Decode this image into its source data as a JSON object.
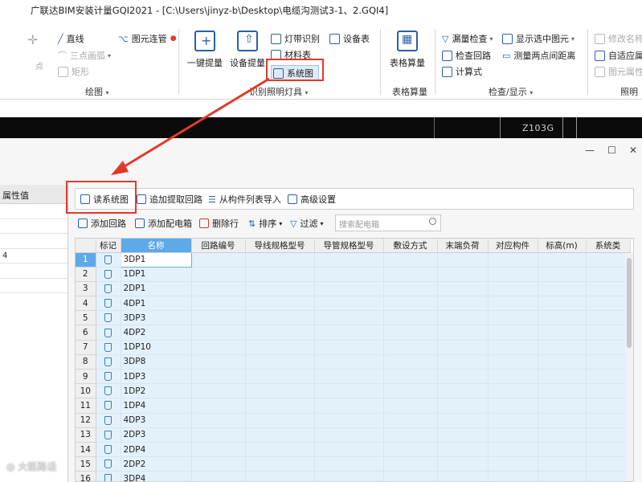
{
  "window": {
    "title": "广联达BIM安装计量GQI2021 - [C:\\Users\\jinyz-b\\Desktop\\电缆沟测试3-1、2.GQI4]"
  },
  "ribbon": {
    "draw_group": {
      "label": "绘图",
      "point": "点",
      "line": "直线",
      "three_point_arc": "三点画弧",
      "rect": "矩形",
      "connect_pipe": "图元连管"
    },
    "lighting_group": {
      "label": "识别照明灯具",
      "one_click": "一键提量",
      "device_extract": "设备提量",
      "light_strip": "灯带识别",
      "device_table": "设备表",
      "material_table": "材料表",
      "system_diagram": "系统图"
    },
    "table_group": {
      "label": "表格算量",
      "table_calc": "表格算量"
    },
    "check_group": {
      "label": "检查/显示",
      "missing_check": "漏量检查",
      "show_selected": "显示选中图元",
      "check_loop": "检查回路",
      "measure_distance": "测量两点间距离",
      "formula": "计算式"
    },
    "right_group": {
      "label": "照明",
      "modify_name": "修改名称",
      "auto_adapt": "自适应属性",
      "component_attr": "图元属性"
    }
  },
  "drawing": {
    "label": "Z103G"
  },
  "dialog": {
    "window_controls": [
      "—",
      "☐",
      "✕"
    ],
    "left_panel": {
      "header": "属性值",
      "rows": [
        "",
        "",
        "",
        "4",
        "",
        ""
      ]
    },
    "toolbar1": {
      "read_system_diagram": "读系统图",
      "append_loop": "追加提取回路",
      "import_from_list": "从构件列表导入",
      "advanced": "高级设置"
    },
    "toolbar2": {
      "add_loop": "添加回路",
      "add_box": "添加配电箱",
      "delete_row": "删除行",
      "sort": "排序",
      "filter": "过滤",
      "search_placeholder": "搜索配电箱"
    },
    "table": {
      "columns": [
        "标记",
        "名称",
        "回路编号",
        "导线规格型号",
        "导管规格型号",
        "敷设方式",
        "末端负荷",
        "对应构件",
        "标高(m)",
        "系统类"
      ],
      "rows": [
        {
          "idx": "1",
          "name": "3DP1"
        },
        {
          "idx": "2",
          "name": "1DP1"
        },
        {
          "idx": "3",
          "name": "2DP1"
        },
        {
          "idx": "4",
          "name": "4DP1"
        },
        {
          "idx": "5",
          "name": "3DP3"
        },
        {
          "idx": "6",
          "name": "4DP2"
        },
        {
          "idx": "7",
          "name": "1DP10"
        },
        {
          "idx": "8",
          "name": "3DP8"
        },
        {
          "idx": "9",
          "name": "1DP3"
        },
        {
          "idx": "10",
          "name": "1DP2"
        },
        {
          "idx": "11",
          "name": "1DP4"
        },
        {
          "idx": "12",
          "name": "4DP3"
        },
        {
          "idx": "13",
          "name": "2DP3"
        },
        {
          "idx": "14",
          "name": "2DP4"
        },
        {
          "idx": "15",
          "name": "2DP2"
        },
        {
          "idx": "16",
          "name": "3DP4"
        }
      ]
    }
  },
  "watermark": "大骶路话",
  "colors": {
    "highlight": "#e23a2a",
    "selection": "#5ea9e8",
    "row_bg": "#e3f1fb",
    "icon": "#2c5fa8"
  }
}
